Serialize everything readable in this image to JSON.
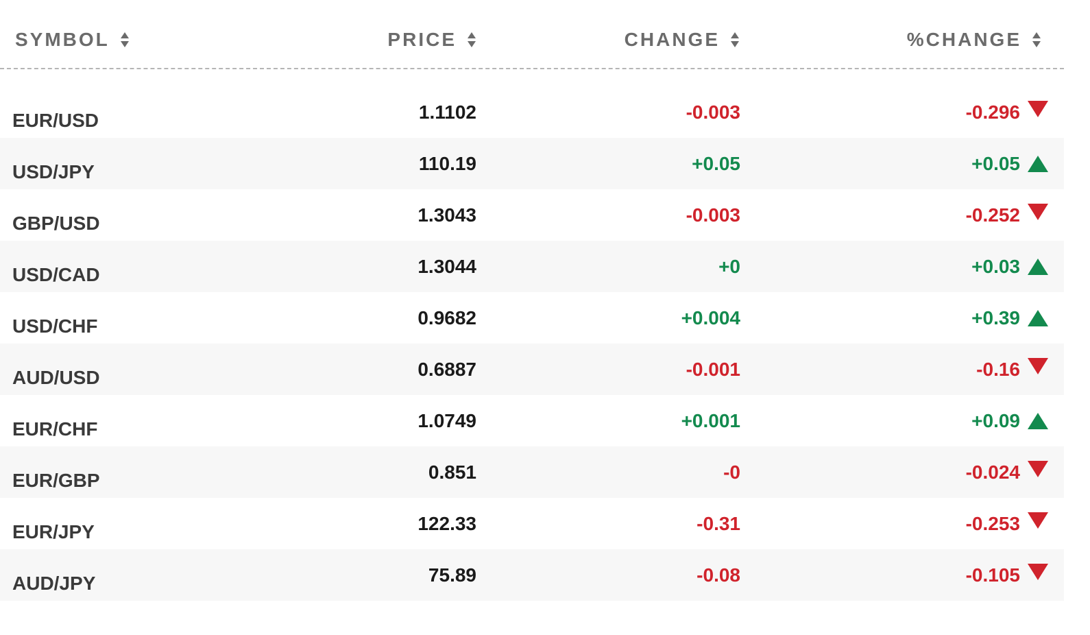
{
  "columns": {
    "symbol": "SYMBOL",
    "price": "PRICE",
    "change": "CHANGE",
    "pct_change": "%CHANGE"
  },
  "colors": {
    "negative": "#d0232c",
    "positive": "#138a4e",
    "header_text": "#6b6b6b",
    "alt_row_bg": "#f7f7f7"
  },
  "icons": {
    "sort": "sort-icon",
    "up": "triangle-up-icon",
    "down": "triangle-down-icon"
  },
  "rows": [
    {
      "symbol": "EUR/USD",
      "price": "1.1102",
      "change": "-0.003",
      "pct_change": "-0.296",
      "direction": "down"
    },
    {
      "symbol": "USD/JPY",
      "price": "110.19",
      "change": "+0.05",
      "pct_change": "+0.05",
      "direction": "up"
    },
    {
      "symbol": "GBP/USD",
      "price": "1.3043",
      "change": "-0.003",
      "pct_change": "-0.252",
      "direction": "down"
    },
    {
      "symbol": "USD/CAD",
      "price": "1.3044",
      "change": "+0",
      "pct_change": "+0.03",
      "direction": "up"
    },
    {
      "symbol": "USD/CHF",
      "price": "0.9682",
      "change": "+0.004",
      "pct_change": "+0.39",
      "direction": "up"
    },
    {
      "symbol": "AUD/USD",
      "price": "0.6887",
      "change": "-0.001",
      "pct_change": "-0.16",
      "direction": "down"
    },
    {
      "symbol": "EUR/CHF",
      "price": "1.0749",
      "change": "+0.001",
      "pct_change": "+0.09",
      "direction": "up"
    },
    {
      "symbol": "EUR/GBP",
      "price": "0.851",
      "change": "-0",
      "pct_change": "-0.024",
      "direction": "down"
    },
    {
      "symbol": "EUR/JPY",
      "price": "122.33",
      "change": "-0.31",
      "pct_change": "-0.253",
      "direction": "down"
    },
    {
      "symbol": "AUD/JPY",
      "price": "75.89",
      "change": "-0.08",
      "pct_change": "-0.105",
      "direction": "down"
    }
  ]
}
